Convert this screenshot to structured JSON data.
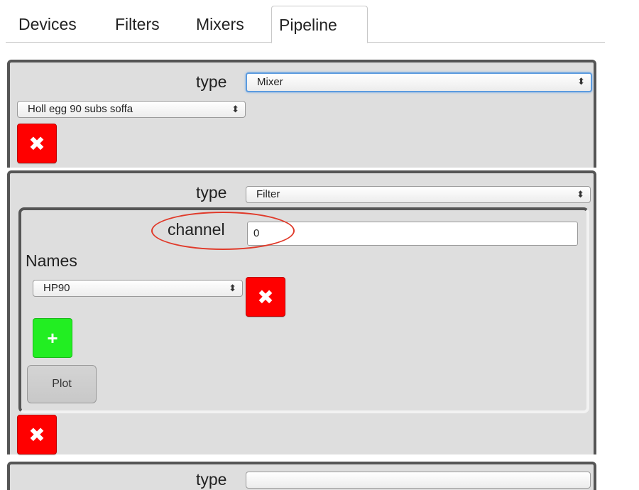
{
  "tabs": [
    {
      "label": "Devices",
      "active": false
    },
    {
      "label": "Filters",
      "active": false
    },
    {
      "label": "Mixers",
      "active": false
    },
    {
      "label": "Pipeline",
      "active": true
    }
  ],
  "step1": {
    "type_label": "type",
    "type_value": "Mixer",
    "mixer_value": "Holl egg 90 subs soffa"
  },
  "step2": {
    "type_label": "type",
    "type_value": "Filter",
    "channel_label": "channel",
    "channel_value": "0",
    "names_label": "Names",
    "name_value": "HP90",
    "plot_label": "Plot"
  },
  "step3": {
    "type_label": "type"
  },
  "icons": {
    "remove": "✖",
    "add": "+",
    "select_arrows": "⬍"
  },
  "colors": {
    "remove": "#ff0000",
    "add": "#22ee22",
    "annotation": "#e03a2a",
    "focus": "#5b9bdf"
  }
}
